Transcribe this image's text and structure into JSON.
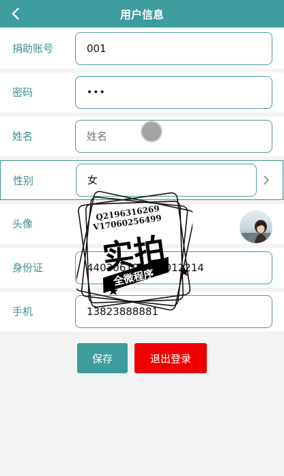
{
  "header": {
    "title": "用户信息",
    "back_icon": "chevron-left-icon"
  },
  "form": {
    "account": {
      "label": "捐助账号",
      "value": "001"
    },
    "password": {
      "label": "密码",
      "value": "•••"
    },
    "name": {
      "label": "姓名",
      "placeholder": "姓名",
      "value": ""
    },
    "gender": {
      "label": "性别",
      "value": "女"
    },
    "avatar": {
      "label": "头像"
    },
    "id_card": {
      "label": "身份证",
      "value": "440306199101012214"
    },
    "phone": {
      "label": "手机",
      "value": "13823888881"
    }
  },
  "buttons": {
    "save": "保存",
    "logout": "退出登录"
  },
  "watermark": {
    "line1": "Q2196316269",
    "line2": "V17060256499",
    "big": "实拍",
    "banner": "全微程序"
  },
  "colors": {
    "primary": "#3d9c9c",
    "danger": "#ee0000",
    "label": "#3c8f8f"
  }
}
